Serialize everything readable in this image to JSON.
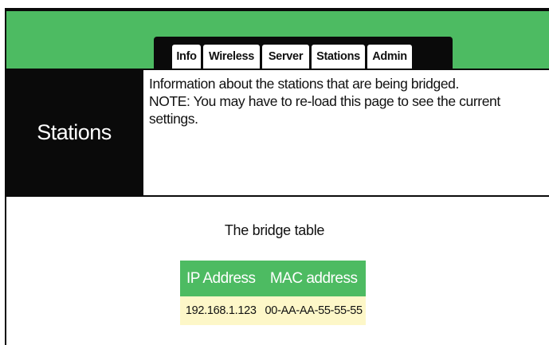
{
  "tabs": [
    {
      "label": "Info"
    },
    {
      "label": "Wireless"
    },
    {
      "label": "Server"
    },
    {
      "label": "Stations"
    },
    {
      "label": "Admin"
    }
  ],
  "sidebar": {
    "title": "Stations"
  },
  "info": {
    "line1": "Information about the stations that are being bridged.",
    "line2": "NOTE: You may have to re-load this page to see the current settings."
  },
  "bridge": {
    "title": "The bridge table",
    "columns": [
      "IP Address",
      "MAC address"
    ],
    "rows": [
      [
        "192.168.1.123",
        "00-AA-AA-55-55-55"
      ]
    ]
  },
  "colors": {
    "accent_green": "#4dbb62",
    "header_black": "#0a0a0a",
    "row_cream": "#fdf7c8"
  }
}
